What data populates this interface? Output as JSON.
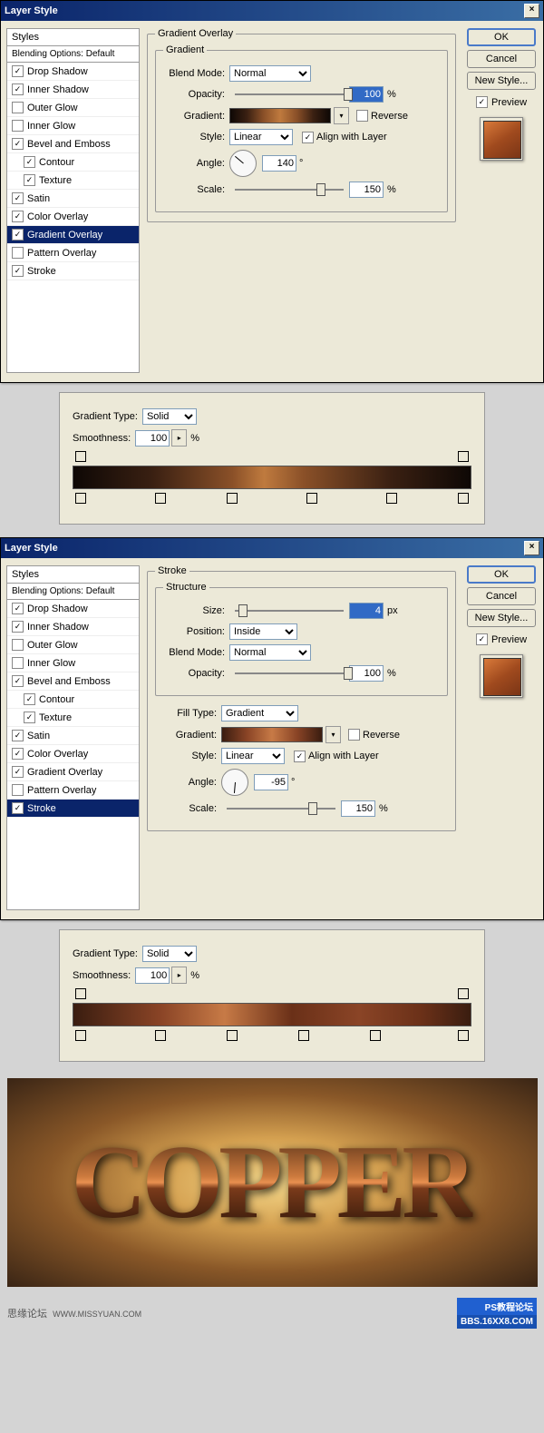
{
  "dialog1": {
    "title": "Layer Style",
    "styles_header": "Styles",
    "blending_opts": "Blending Options: Default",
    "items": [
      {
        "label": "Drop Shadow",
        "on": true,
        "sel": false,
        "ind": false
      },
      {
        "label": "Inner Shadow",
        "on": true,
        "sel": false,
        "ind": false
      },
      {
        "label": "Outer Glow",
        "on": false,
        "sel": false,
        "ind": false
      },
      {
        "label": "Inner Glow",
        "on": false,
        "sel": false,
        "ind": false
      },
      {
        "label": "Bevel and Emboss",
        "on": true,
        "sel": false,
        "ind": false
      },
      {
        "label": "Contour",
        "on": true,
        "sel": false,
        "ind": true
      },
      {
        "label": "Texture",
        "on": true,
        "sel": false,
        "ind": true
      },
      {
        "label": "Satin",
        "on": true,
        "sel": false,
        "ind": false
      },
      {
        "label": "Color Overlay",
        "on": true,
        "sel": false,
        "ind": false
      },
      {
        "label": "Gradient Overlay",
        "on": true,
        "sel": true,
        "ind": false
      },
      {
        "label": "Pattern Overlay",
        "on": false,
        "sel": false,
        "ind": false
      },
      {
        "label": "Stroke",
        "on": true,
        "sel": false,
        "ind": false
      }
    ],
    "panel_title": "Gradient Overlay",
    "group_title": "Gradient",
    "blend_mode_lbl": "Blend Mode:",
    "blend_mode": "Normal",
    "opacity_lbl": "Opacity:",
    "opacity": "100",
    "pct": "%",
    "gradient_lbl": "Gradient:",
    "reverse_lbl": "Reverse",
    "style_lbl": "Style:",
    "style": "Linear",
    "align_lbl": "Align with Layer",
    "angle_lbl": "Angle:",
    "angle": "140",
    "deg": "°",
    "scale_lbl": "Scale:",
    "scale": "150",
    "gradient_css": "linear-gradient(to right,#0e0805,#3a2012,#8a5028,#bf7a3e,#8a5028,#3a2012,#0e0805)"
  },
  "common_right": {
    "ok": "OK",
    "cancel": "Cancel",
    "new_style": "New Style...",
    "preview": "Preview"
  },
  "editor1": {
    "type_lbl": "Gradient Type:",
    "type": "Solid",
    "smooth_lbl": "Smoothness:",
    "smooth": "100",
    "pct": "%",
    "gradient_css": "linear-gradient(to right,#0e0805,#3a2012 20%,#8a5028 40%,#bf7a3e 48%,#8a5028 58%,#3a2012 80%,#0e0805)",
    "stops": [
      2,
      22,
      40,
      60,
      80,
      98
    ]
  },
  "dialog2": {
    "title": "Layer Style",
    "panel_title": "Stroke",
    "group1": "Structure",
    "size_lbl": "Size:",
    "size": "4",
    "px": "px",
    "position_lbl": "Position:",
    "position": "Inside",
    "blend_mode_lbl": "Blend Mode:",
    "blend_mode": "Normal",
    "opacity_lbl": "Opacity:",
    "opacity": "100",
    "pct": "%",
    "fill_type_lbl": "Fill Type:",
    "fill_type": "Gradient",
    "gradient_lbl": "Gradient:",
    "reverse_lbl": "Reverse",
    "style_lbl": "Style:",
    "style": "Linear",
    "align_lbl": "Align with Layer",
    "angle_lbl": "Angle:",
    "angle": "-95",
    "deg": "°",
    "scale_lbl": "Scale:",
    "scale": "150",
    "gradient_css": "linear-gradient(to right,#3a1d10,#8a4426,#c77a46,#8a4426,#3a1d10)",
    "items": [
      {
        "label": "Drop Shadow",
        "on": true,
        "sel": false,
        "ind": false
      },
      {
        "label": "Inner Shadow",
        "on": true,
        "sel": false,
        "ind": false
      },
      {
        "label": "Outer Glow",
        "on": false,
        "sel": false,
        "ind": false
      },
      {
        "label": "Inner Glow",
        "on": false,
        "sel": false,
        "ind": false
      },
      {
        "label": "Bevel and Emboss",
        "on": true,
        "sel": false,
        "ind": false
      },
      {
        "label": "Contour",
        "on": true,
        "sel": false,
        "ind": true
      },
      {
        "label": "Texture",
        "on": true,
        "sel": false,
        "ind": true
      },
      {
        "label": "Satin",
        "on": true,
        "sel": false,
        "ind": false
      },
      {
        "label": "Color Overlay",
        "on": true,
        "sel": false,
        "ind": false
      },
      {
        "label": "Gradient Overlay",
        "on": true,
        "sel": false,
        "ind": false
      },
      {
        "label": "Pattern Overlay",
        "on": false,
        "sel": false,
        "ind": false
      },
      {
        "label": "Stroke",
        "on": true,
        "sel": true,
        "ind": false
      }
    ]
  },
  "editor2": {
    "type_lbl": "Gradient Type:",
    "type": "Solid",
    "smooth_lbl": "Smoothness:",
    "smooth": "100",
    "pct": "%",
    "gradient_css": "linear-gradient(to right,#3a1d10,#8a4426 22%,#c77a46 38%,#6a3018 55%,#8a4426 72%,#6a3018 88%,#3a1d10)",
    "stops": [
      2,
      22,
      40,
      58,
      76,
      98
    ]
  },
  "result_text": "COPPER",
  "footer_left": "思缘论坛",
  "footer_url": "WWW.MISSYUAN.COM",
  "badge_top": "PS教程论坛",
  "badge_bot": "BBS.16XX8.COM"
}
